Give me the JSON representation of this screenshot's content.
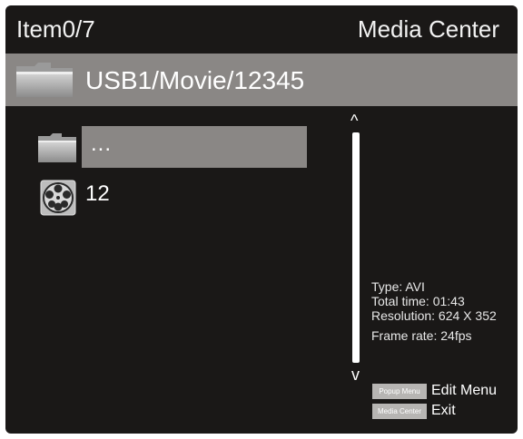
{
  "header": {
    "item_count": "Item0/7",
    "title": "Media Center"
  },
  "path_bar": {
    "icon": "folder-icon",
    "path": "USB1/Movie/12345"
  },
  "file_list": [
    {
      "label": "...",
      "icon": "folder-icon",
      "selected": true
    },
    {
      "label": "12",
      "icon": "film-reel-icon",
      "selected": false
    }
  ],
  "scrollbar": {
    "up_glyph": "^",
    "down_glyph": "v"
  },
  "file_info": {
    "type": "Type: AVI",
    "total_time": "Total time: 01:43",
    "resolution": "Resolution: 624 X 352",
    "frame_rate": "Frame rate: 24fps"
  },
  "legend": [
    {
      "key": "Popup Menu",
      "label": "Edit Menu"
    },
    {
      "key": "Media Center",
      "label": "Exit"
    }
  ],
  "colors": {
    "background": "#1a1817",
    "bar_gray": "#8a8785",
    "key_gray": "#b7b5b3",
    "text": "#ffffff"
  }
}
